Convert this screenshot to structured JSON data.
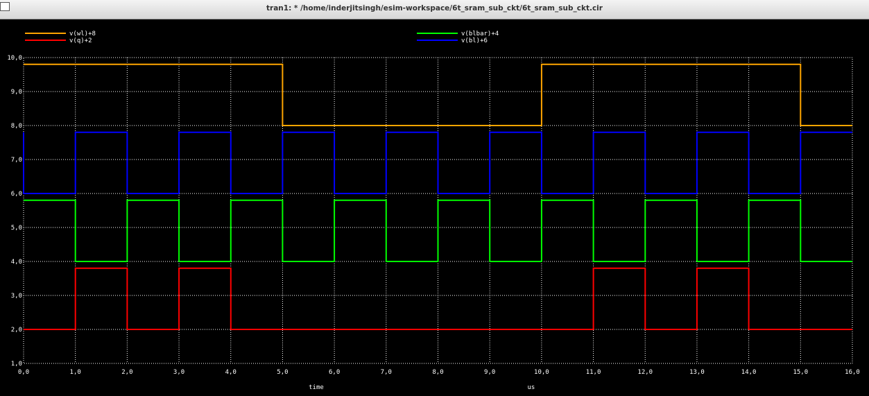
{
  "window": {
    "title": "tran1: * /home/inderjitsingh/esim-workspace/6t_sram_sub_ckt/6t_sram_sub_ckt.cir"
  },
  "chart_data": {
    "type": "line",
    "xlabel": "time",
    "xunit": "us",
    "ylabel": "",
    "xlim": [
      0,
      16
    ],
    "ylim": [
      1,
      10
    ],
    "x_ticks": [
      "0,0",
      "1,0",
      "2,0",
      "3,0",
      "4,0",
      "5,0",
      "6,0",
      "7,0",
      "8,0",
      "9,0",
      "10,0",
      "11,0",
      "12,0",
      "13,0",
      "14,0",
      "15,0",
      "16,0"
    ],
    "y_ticks": [
      "1,0",
      "2,0",
      "3,0",
      "4,0",
      "5,0",
      "6,0",
      "7,0",
      "8,0",
      "9,0",
      "10,0"
    ],
    "grid": true,
    "legend_placement": "top",
    "series": [
      {
        "name": "v(wl)+8",
        "color": "#ffa500",
        "points": [
          [
            0,
            9.8
          ],
          [
            5,
            9.8
          ],
          [
            5,
            8.0
          ],
          [
            10,
            8.0
          ],
          [
            10,
            9.8
          ],
          [
            15,
            9.8
          ],
          [
            15,
            8.0
          ],
          [
            16,
            8.0
          ]
        ]
      },
      {
        "name": "v(q)+2",
        "color": "#ff0000",
        "points": [
          [
            0,
            2.0
          ],
          [
            1,
            2.0
          ],
          [
            1,
            3.8
          ],
          [
            2,
            3.8
          ],
          [
            2,
            2.0
          ],
          [
            3,
            2.0
          ],
          [
            3,
            3.8
          ],
          [
            4,
            3.8
          ],
          [
            4,
            2.0
          ],
          [
            11,
            2.0
          ],
          [
            11,
            3.8
          ],
          [
            12,
            3.8
          ],
          [
            12,
            2.0
          ],
          [
            13,
            2.0
          ],
          [
            13,
            3.8
          ],
          [
            14,
            3.8
          ],
          [
            14,
            2.0
          ],
          [
            16,
            2.0
          ]
        ]
      },
      {
        "name": "v(blbar)+4",
        "color": "#00ff00",
        "points": [
          [
            0,
            5.8
          ],
          [
            1,
            5.8
          ],
          [
            1,
            4.0
          ],
          [
            2,
            4.0
          ],
          [
            2,
            5.8
          ],
          [
            3,
            5.8
          ],
          [
            3,
            4.0
          ],
          [
            4,
            4.0
          ],
          [
            4,
            5.8
          ],
          [
            5,
            5.8
          ],
          [
            5,
            4.0
          ],
          [
            6,
            4.0
          ],
          [
            6,
            5.8
          ],
          [
            7,
            5.8
          ],
          [
            7,
            4.0
          ],
          [
            8,
            4.0
          ],
          [
            8,
            5.8
          ],
          [
            9,
            5.8
          ],
          [
            9,
            4.0
          ],
          [
            10,
            4.0
          ],
          [
            10,
            5.8
          ],
          [
            11,
            5.8
          ],
          [
            11,
            4.0
          ],
          [
            12,
            4.0
          ],
          [
            12,
            5.8
          ],
          [
            13,
            5.8
          ],
          [
            13,
            4.0
          ],
          [
            14,
            4.0
          ],
          [
            14,
            5.8
          ],
          [
            15,
            5.8
          ],
          [
            15,
            4.0
          ],
          [
            16,
            4.0
          ]
        ]
      },
      {
        "name": "v(bl)+6",
        "color": "#0000ff",
        "points": [
          [
            0,
            7.8
          ],
          [
            0,
            6.0
          ],
          [
            1,
            6.0
          ],
          [
            1,
            7.8
          ],
          [
            2,
            7.8
          ],
          [
            2,
            6.0
          ],
          [
            3,
            6.0
          ],
          [
            3,
            7.8
          ],
          [
            4,
            7.8
          ],
          [
            4,
            6.0
          ],
          [
            5,
            6.0
          ],
          [
            5,
            7.8
          ],
          [
            6,
            7.8
          ],
          [
            6,
            6.0
          ],
          [
            7,
            6.0
          ],
          [
            7,
            7.8
          ],
          [
            8,
            7.8
          ],
          [
            8,
            6.0
          ],
          [
            9,
            6.0
          ],
          [
            9,
            7.8
          ],
          [
            10,
            7.8
          ],
          [
            10,
            6.0
          ],
          [
            11,
            6.0
          ],
          [
            11,
            7.8
          ],
          [
            12,
            7.8
          ],
          [
            12,
            6.0
          ],
          [
            13,
            6.0
          ],
          [
            13,
            7.8
          ],
          [
            14,
            7.8
          ],
          [
            14,
            6.0
          ],
          [
            15,
            6.0
          ],
          [
            15,
            7.8
          ],
          [
            16,
            7.8
          ]
        ]
      }
    ]
  }
}
